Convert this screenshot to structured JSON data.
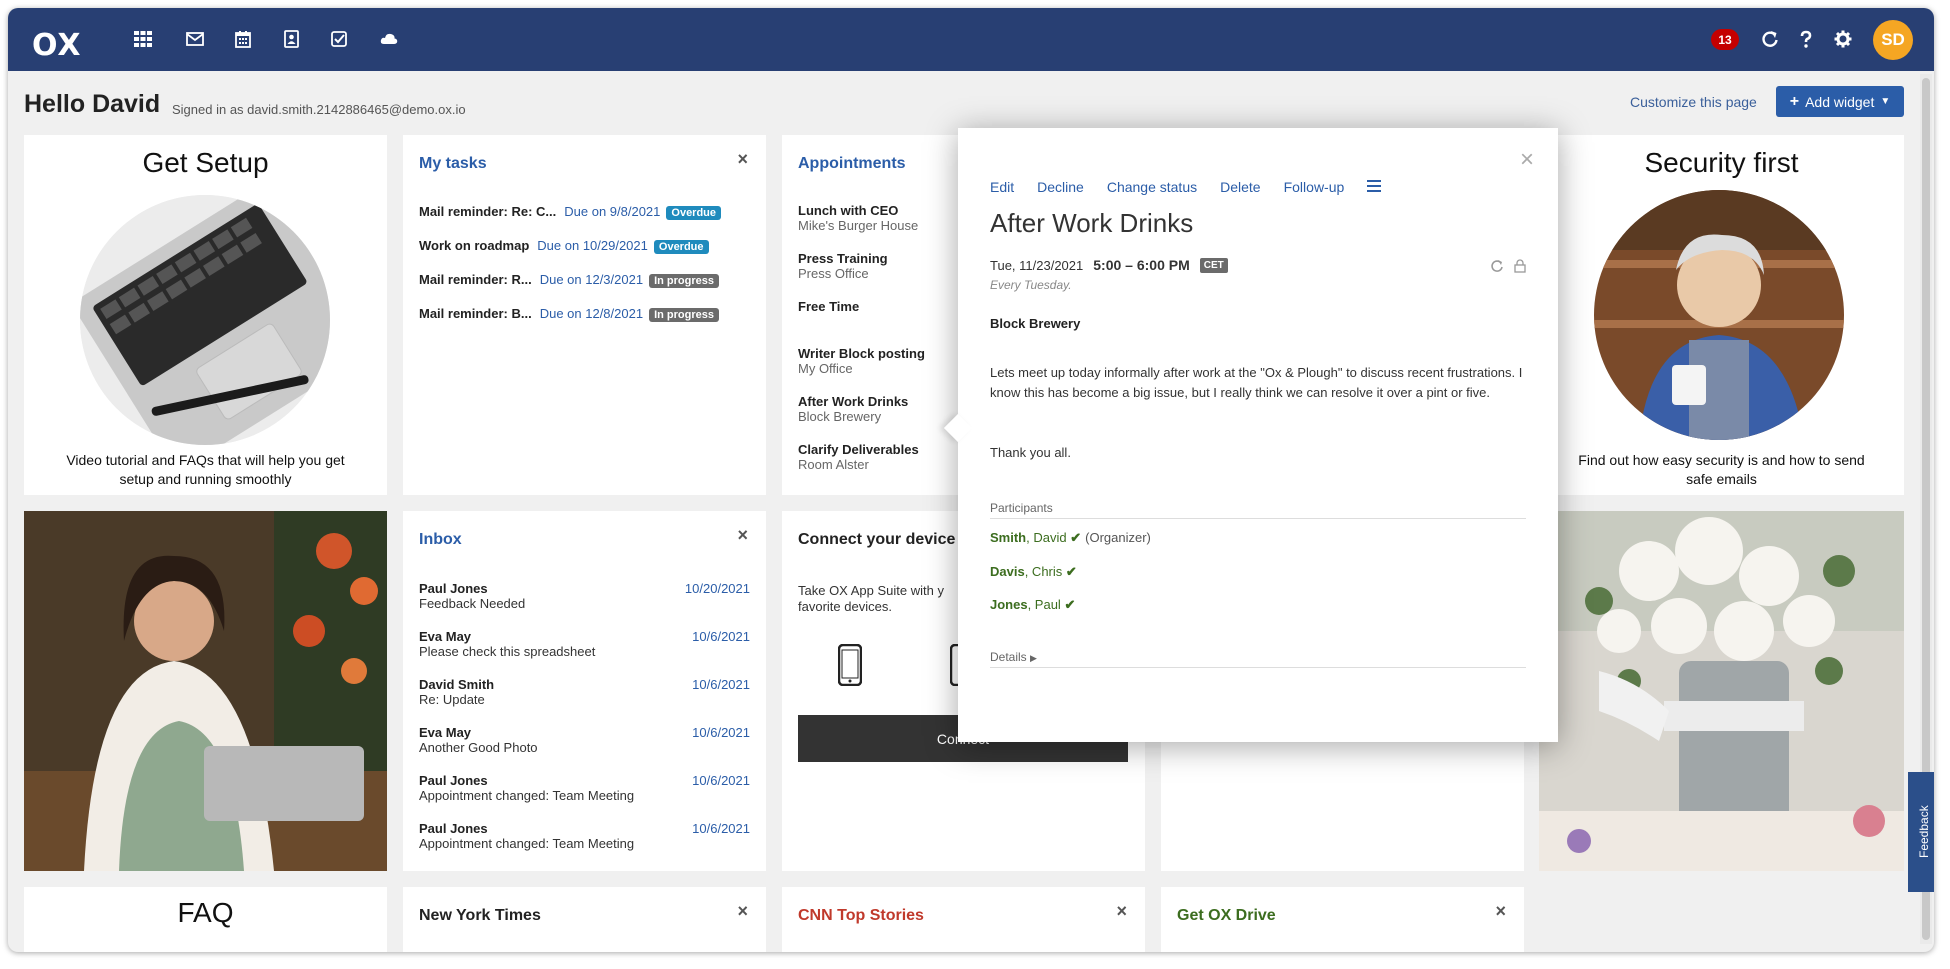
{
  "topbar": {
    "logo": "OX",
    "notification_count": "13",
    "avatar_initials": "SD",
    "icons": [
      "apps-grid-icon",
      "mail-icon",
      "calendar-icon",
      "address-book-icon",
      "tasks-icon",
      "drive-cloud-icon",
      "refresh-icon",
      "help-icon",
      "settings-icon"
    ]
  },
  "header": {
    "greeting": "Hello David",
    "signed_in": "Signed in as david.smith.2142886465@demo.ox.io",
    "customize": "Customize this page",
    "add_widget": "Add widget"
  },
  "get_setup": {
    "title": "Get Setup",
    "text": "Video tutorial and FAQs that will help you get setup and running smoothly"
  },
  "security": {
    "title": "Security first",
    "text": "Find out how easy security is and how to send safe emails"
  },
  "tasks": {
    "title": "My tasks",
    "items": [
      {
        "name": "Mail reminder: Re: C...",
        "due": "Due on 9/8/2021",
        "status": "Overdue"
      },
      {
        "name": "Work on roadmap",
        "due": "Due on 10/29/2021",
        "status": "Overdue"
      },
      {
        "name": "Mail reminder: R...",
        "due": "Due on 12/3/2021",
        "status": "In progress"
      },
      {
        "name": "Mail reminder: B...",
        "due": "Due on 12/8/2021",
        "status": "In progress"
      }
    ]
  },
  "appointments": {
    "title": "Appointments",
    "items": [
      {
        "title": "Lunch with CEO",
        "location": "Mike's Burger House"
      },
      {
        "title": "Press Training",
        "location": "Press Office"
      },
      {
        "title": "Free Time",
        "location": ""
      },
      {
        "title": "Writer Block posting",
        "location": "My Office"
      },
      {
        "title": "After Work Drinks",
        "location": "Block Brewery"
      },
      {
        "title": "Clarify Deliverables",
        "location": "Room Alster"
      }
    ]
  },
  "inbox": {
    "title": "Inbox",
    "items": [
      {
        "from": "Paul Jones",
        "subject": "Feedback Needed",
        "date": "10/20/2021"
      },
      {
        "from": "Eva May",
        "subject": "Please check this spreadsheet",
        "date": "10/6/2021"
      },
      {
        "from": "David Smith",
        "subject": "Re: Update",
        "date": "10/6/2021"
      },
      {
        "from": "Eva May",
        "subject": "Another Good Photo",
        "date": "10/6/2021"
      },
      {
        "from": "Paul Jones",
        "subject": "Appointment changed: Team Meeting",
        "date": "10/6/2021"
      },
      {
        "from": "Paul Jones",
        "subject": "Appointment changed: Team Meeting",
        "date": "10/6/2021"
      }
    ]
  },
  "connect": {
    "title": "Connect your device",
    "text": "Take OX App Suite with y favorite devices.",
    "button": "Connect"
  },
  "bottom": {
    "faq": "FAQ",
    "nyt": "New York Times",
    "cnn": "CNN Top Stories",
    "drive": "Get OX Drive"
  },
  "popup": {
    "actions": [
      "Edit",
      "Decline",
      "Change status",
      "Delete",
      "Follow-up"
    ],
    "title": "After Work Drinks",
    "date": "Tue, 11/23/2021",
    "time": "5:00 – 6:00 PM",
    "timezone": "CET",
    "recurrence": "Every Tuesday.",
    "location": "Block Brewery",
    "description": "Lets meet up today informally after work at the \"Ox & Plough\" to discuss recent frustrations. I know this has become a big issue, but I really think we can resolve it over a pint or five.",
    "thanks": "Thank you all.",
    "participants_label": "Participants",
    "participants": [
      {
        "last": "Smith",
        "first": ", David",
        "role": "(Organizer)"
      },
      {
        "last": "Davis",
        "first": ", Chris",
        "role": ""
      },
      {
        "last": "Jones",
        "first": ", Paul",
        "role": ""
      }
    ],
    "details_label": "Details"
  },
  "feedback": "Feedback",
  "colors": {
    "topbar": "#283f73",
    "overdue": "#1f8bbd",
    "in_progress": "#6b6b6b",
    "link": "#2b5da8",
    "participant": "#3c6d1f",
    "cnn": "#c0392b",
    "drive": "#3c6d1f"
  }
}
